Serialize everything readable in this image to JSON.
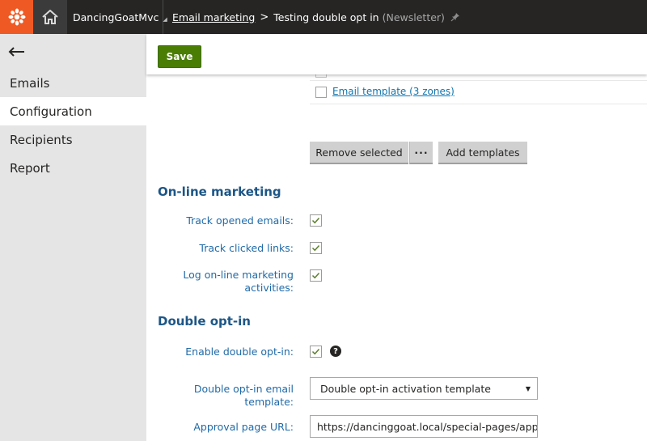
{
  "header": {
    "site_name": "DancingGoatMvc",
    "breadcrumb_app": "Email marketing",
    "breadcrumb_separator": ">",
    "page_title": "Testing double opt in",
    "page_type": "(Newsletter)"
  },
  "sidebar": {
    "items": [
      {
        "label": "Emails"
      },
      {
        "label": "Configuration"
      },
      {
        "label": "Recipients"
      },
      {
        "label": "Report"
      }
    ],
    "active": "Configuration"
  },
  "toolbar": {
    "save_label": "Save"
  },
  "templates": {
    "row_label": "Email template (3 zones)",
    "remove_label": "Remove selected",
    "more_label": "···",
    "add_label": "Add templates"
  },
  "online_marketing": {
    "heading": "On-line marketing",
    "track_opened_label": "Track opened emails:",
    "track_opened_checked": true,
    "track_clicked_label": "Track clicked links:",
    "track_clicked_checked": true,
    "log_activities_label": "Log on-line marketing activities:",
    "log_activities_checked": true
  },
  "double_opt_in": {
    "heading": "Double opt-in",
    "enable_label": "Enable double opt-in:",
    "enable_checked": true,
    "help_symbol": "?",
    "template_label": "Double opt-in email template:",
    "template_value": "Double opt-in activation template",
    "approval_label": "Approval page URL:",
    "approval_value": "https://dancinggoat.local/special-pages/approva"
  },
  "colors": {
    "accent": "#ef5a24",
    "save_button": "#497d04",
    "label_blue": "#1f6aa8",
    "heading_blue": "#1c5687"
  }
}
